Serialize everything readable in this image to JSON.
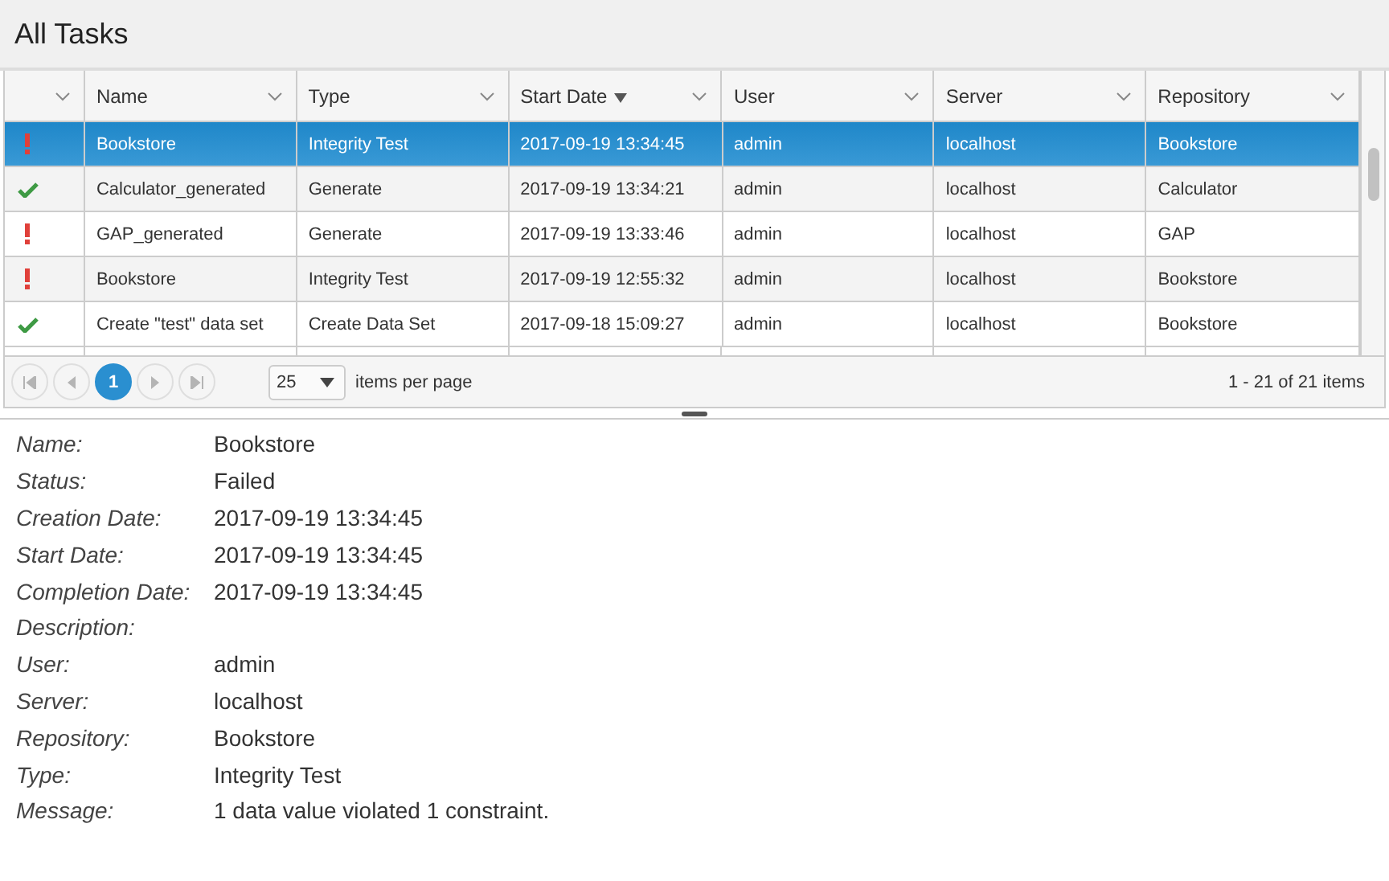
{
  "title": "All Tasks",
  "table": {
    "columns": [
      {
        "kind": "status"
      },
      {
        "kind": "text",
        "label": "Name"
      },
      {
        "kind": "text",
        "label": "Type"
      },
      {
        "kind": "text",
        "label": "Start Date",
        "sort_descending": true
      },
      {
        "kind": "text",
        "label": "User"
      },
      {
        "kind": "text",
        "label": "Server"
      },
      {
        "kind": "text",
        "label": "Repository"
      }
    ],
    "rows": [
      {
        "kind": "failed",
        "selected": true,
        "cells": [
          "",
          "Bookstore",
          "Integrity Test",
          "2017-09-19 13:34:45",
          "admin",
          "localhost",
          "Bookstore"
        ]
      },
      {
        "kind": "success",
        "selected": false,
        "cells": [
          "",
          "Calculator_generated",
          "Generate",
          "2017-09-19 13:34:21",
          "admin",
          "localhost",
          "Calculator"
        ]
      },
      {
        "kind": "failed",
        "selected": false,
        "cells": [
          "",
          "GAP_generated",
          "Generate",
          "2017-09-19 13:33:46",
          "admin",
          "localhost",
          "GAP"
        ]
      },
      {
        "kind": "failed",
        "selected": false,
        "cells": [
          "",
          "Bookstore",
          "Integrity Test",
          "2017-09-19 12:55:32",
          "admin",
          "localhost",
          "Bookstore"
        ]
      },
      {
        "kind": "success",
        "selected": false,
        "cells": [
          "",
          "Create \"test\" data set",
          "Create Data Set",
          "2017-09-18 15:09:27",
          "admin",
          "localhost",
          "Bookstore"
        ]
      }
    ]
  },
  "pager": {
    "nav": [
      {
        "kind": "first",
        "disabled": true
      },
      {
        "kind": "prev",
        "disabled": true
      },
      {
        "kind": "page",
        "label": "1",
        "selected": true
      },
      {
        "kind": "next",
        "disabled": true
      },
      {
        "kind": "last",
        "disabled": true
      }
    ],
    "page_size": "25",
    "page_size_label": "items per page",
    "summary": "1 - 21 of 21 items"
  },
  "details": [
    {
      "label": "Name:",
      "value": "Bookstore"
    },
    {
      "label": "Status:",
      "value": "Failed"
    },
    {
      "label": "Creation Date:",
      "value": "2017-09-19 13:34:45"
    },
    {
      "label": "Start Date:",
      "value": "2017-09-19 13:34:45"
    },
    {
      "label": "Completion Date:",
      "value": "2017-09-19 13:34:45"
    },
    {
      "label": "Description:"
    },
    {
      "label": "User:",
      "value": "admin"
    },
    {
      "label": "Server:",
      "value": "localhost"
    },
    {
      "label": "Repository:",
      "value": "Bookstore"
    },
    {
      "label": "Type:",
      "value": "Integrity Test"
    },
    {
      "label": "Message:",
      "value": "1 data value violated 1 constraint."
    }
  ]
}
